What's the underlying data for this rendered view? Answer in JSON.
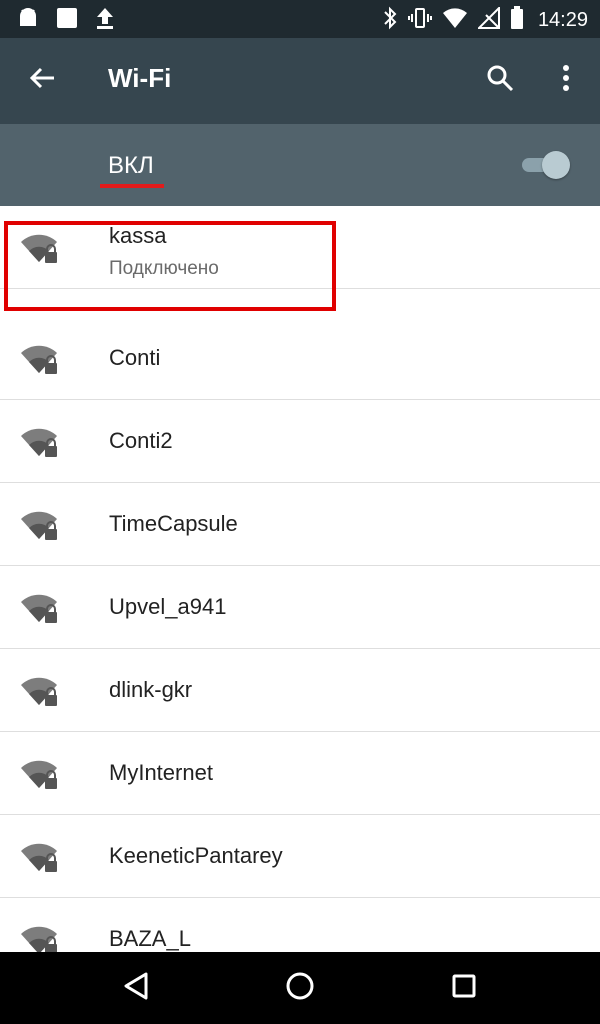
{
  "status_bar": {
    "time": "14:29",
    "icons": [
      "android-icon",
      "image-icon",
      "upload-icon",
      "bluetooth-icon",
      "vibrate-icon",
      "wifi-icon",
      "no-signal-icon",
      "battery-icon"
    ]
  },
  "app_bar": {
    "title": "Wi-Fi",
    "back_icon": "arrow-back-icon",
    "search_icon": "search-icon",
    "more_icon": "more-vert-icon"
  },
  "switch": {
    "label": "ВКЛ",
    "state": "on"
  },
  "networks": [
    {
      "ssid": "kassa",
      "status": "Подключено",
      "secured": true
    },
    {
      "ssid": "Conti",
      "secured": true
    },
    {
      "ssid": "Conti2",
      "secured": true
    },
    {
      "ssid": "TimeCapsule",
      "secured": true
    },
    {
      "ssid": "Upvel_a941",
      "secured": true
    },
    {
      "ssid": "dlink-gkr",
      "secured": true
    },
    {
      "ssid": "MyInternet",
      "secured": true
    },
    {
      "ssid": "KeeneticPantarey",
      "secured": true
    },
    {
      "ssid": "BAZA_L",
      "secured": true
    }
  ],
  "nav_bar": {
    "back": "nav-back-icon",
    "home": "nav-home-icon",
    "recents": "nav-recents-icon"
  },
  "colors": {
    "status_bar": "#1f2a30",
    "app_bar": "#36464f",
    "switch_bar": "#52636c",
    "highlight": "#e00000",
    "accent": "#8ba1ab"
  }
}
